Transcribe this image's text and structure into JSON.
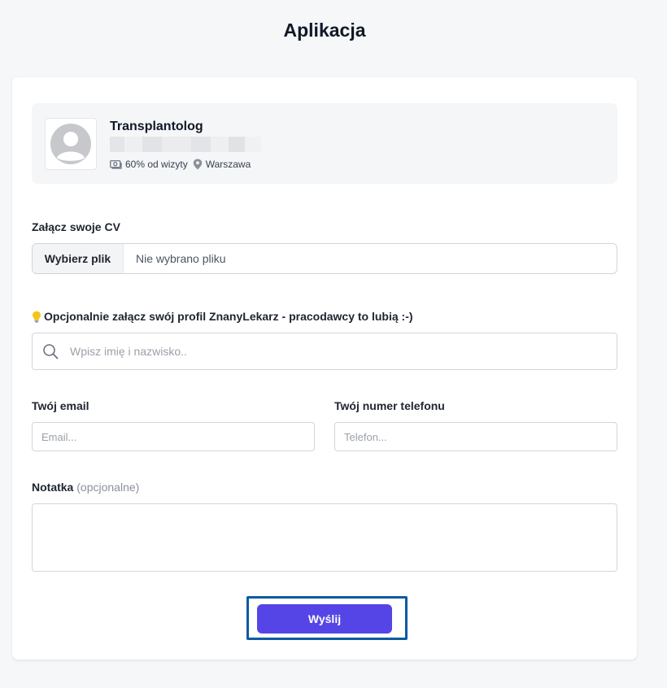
{
  "page": {
    "title": "Aplikacja"
  },
  "job": {
    "title": "Transplantolog",
    "commission": "60% od wizyty",
    "location": "Warszawa"
  },
  "cv": {
    "label": "Załącz swoje CV",
    "choose_button": "Wybierz plik",
    "status": "Nie wybrano pliku"
  },
  "profile": {
    "label": "Opcjonalnie załącz swój profil ZnanyLekarz - pracodawcy to lubią :-)",
    "search_placeholder": "Wpisz imię i nazwisko.."
  },
  "contact": {
    "email_label": "Twój email",
    "email_placeholder": "Email...",
    "phone_label": "Twój numer telefonu",
    "phone_placeholder": "Telefon..."
  },
  "note": {
    "label": "Notatka",
    "optional": "(opcjonalne)"
  },
  "submit": {
    "label": "Wyślij"
  },
  "icons": {
    "avatar": "user-avatar-placeholder",
    "commission": "money-icon",
    "location": "map-pin-icon",
    "hint": "lightbulb-icon",
    "search": "search-icon"
  },
  "colors": {
    "accent": "#5645e6",
    "highlight_frame": "#0b5aa2",
    "background": "#f6f7f9"
  }
}
